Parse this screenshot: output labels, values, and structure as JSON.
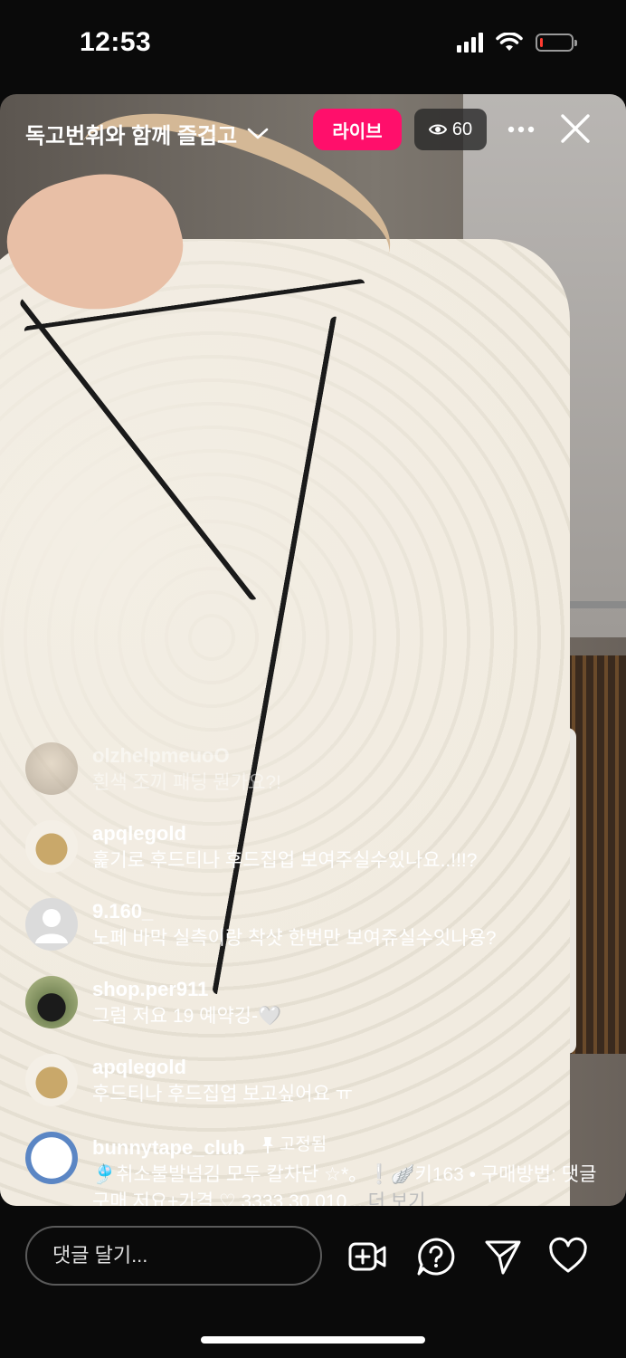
{
  "status_bar": {
    "time": "12:53",
    "battery_level": 0.1,
    "battery_color": "#ff3b30"
  },
  "live_header": {
    "title": "독고번휘와 함께 즐겁고",
    "live_badge": "라이브",
    "live_badge_color": "#ff0f6b",
    "viewer_count": "60",
    "icons": [
      "chevron-down-icon",
      "eye-icon",
      "more-icon",
      "close-icon"
    ]
  },
  "comments": [
    {
      "username": "olzhelpmeuoO",
      "text": "흰색 조끼 패딩 뭔가요?!",
      "faded": true
    },
    {
      "username": "apqlegold",
      "text": "훑기로 후드티나 후드집업 보여주실수있나요..!!!?"
    },
    {
      "username": "9.160_",
      "text": "노페 바막 실측이랑 착샷 한번만 보여쥬실수잇나용?"
    },
    {
      "username": "shop.per911",
      "text": "그럼 저요 19 예약깅-🤍"
    },
    {
      "username": "apqlegold",
      "text": "후드티나 후드집업 보고싶어요 ㅠ"
    }
  ],
  "pinned_comment": {
    "username": "bunnytape_club",
    "pinned_label": "고정됨",
    "text": "🎐취소불발넘김 모두 칼차단 ☆*。❕🪽키163 • 구매방법: 댓글구매 저요+가격 ♡ 3333 30 010...",
    "more_label": "더 보기"
  },
  "bottom_bar": {
    "comment_placeholder": "댓글 달기...",
    "icons": [
      "add-video-icon",
      "question-icon",
      "send-icon",
      "heart-icon"
    ]
  }
}
